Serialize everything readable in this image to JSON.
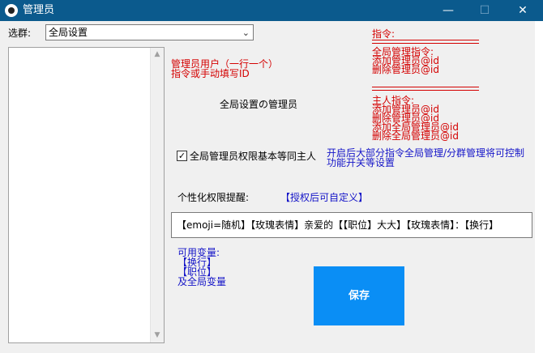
{
  "window": {
    "title": "管理员",
    "minimize_glyph": "—",
    "maximize_glyph": "☐",
    "close_glyph": "✕"
  },
  "filter": {
    "label": "选群:",
    "selected": "全局设置"
  },
  "admin_hint": {
    "line1": "管理员用户（一行一个）",
    "line2": "指令或手动填写ID"
  },
  "section_title": "全局设置の管理员",
  "commands": {
    "header": "指令:",
    "global": [
      "全局管理指令:",
      "添加管理员@id",
      "删除管理员@id"
    ],
    "owner": [
      "主人指令:",
      "添加管理员@id",
      "删除管理员@id",
      "添加全局管理员@id",
      "删除全局管理员@id"
    ]
  },
  "checkbox": {
    "label": "全局管理员权限基本等同主人",
    "checked": true,
    "mark": "✓"
  },
  "note": {
    "line1": "开启后大部分指令全局管理/分群管理将可控制",
    "line2": "功能开关等设置"
  },
  "reminder": {
    "label": "个性化权限提醒:",
    "custom_tag": "【授权后可自定义】",
    "value": "【emoji=随机】【玫瑰表情】亲爱的【【职位】大大】【玫瑰表情】：【换行】"
  },
  "variables": {
    "title": "可用变量:",
    "items": [
      "【换行】",
      "【职位】",
      "及全局变量"
    ]
  },
  "save_button": "保存",
  "colors": {
    "titlebar": "#0b5a8d",
    "accent_red": "#d40000",
    "accent_blue": "#1515c8",
    "save": "#0a8ef5"
  }
}
